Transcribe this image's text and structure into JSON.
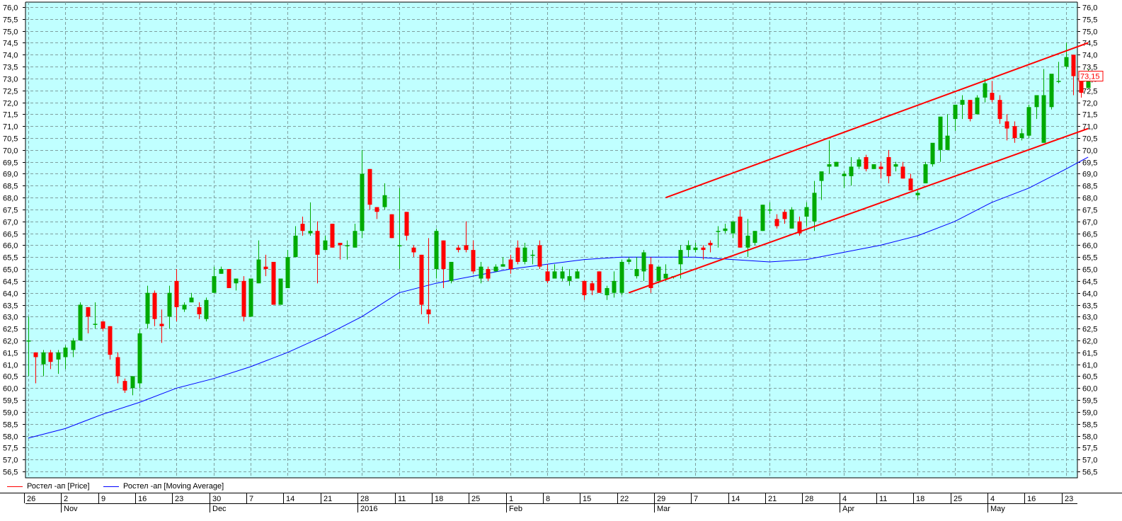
{
  "chart_data": {
    "type": "candlestick",
    "title": "",
    "y_range": [
      56.5,
      76.0
    ],
    "y_tick_step": 0.5,
    "last_price_label": "73,15",
    "colors": {
      "up": "#00aa00",
      "down": "#ff0000",
      "moving_average": "#0000ff",
      "background": "#c0ffff",
      "channel": "#ff0000"
    },
    "grid": true,
    "x_ticks": [
      {
        "label": "26",
        "i": 0
      },
      {
        "label": "2",
        "i": 5
      },
      {
        "label": "9",
        "i": 10
      },
      {
        "label": "16",
        "i": 15
      },
      {
        "label": "23",
        "i": 20
      },
      {
        "label": "30",
        "i": 25
      },
      {
        "label": "7",
        "i": 30
      },
      {
        "label": "14",
        "i": 35
      },
      {
        "label": "21",
        "i": 40
      },
      {
        "label": "28",
        "i": 45
      },
      {
        "label": "11",
        "i": 50
      },
      {
        "label": "18",
        "i": 55
      },
      {
        "label": "25",
        "i": 60
      },
      {
        "label": "1",
        "i": 65
      },
      {
        "label": "8",
        "i": 70
      },
      {
        "label": "15",
        "i": 75
      },
      {
        "label": "22",
        "i": 80
      },
      {
        "label": "29",
        "i": 85
      },
      {
        "label": "7",
        "i": 90
      },
      {
        "label": "14",
        "i": 95
      },
      {
        "label": "21",
        "i": 100
      },
      {
        "label": "28",
        "i": 105
      },
      {
        "label": "4",
        "i": 110
      },
      {
        "label": "11",
        "i": 115
      },
      {
        "label": "18",
        "i": 120
      },
      {
        "label": "25",
        "i": 125
      },
      {
        "label": "4",
        "i": 130
      },
      {
        "label": "16",
        "i": 135
      },
      {
        "label": "23",
        "i": 140
      }
    ],
    "month_labels": [
      {
        "label": "Nov",
        "i": 5
      },
      {
        "label": "Dec",
        "i": 25
      },
      {
        "label": "2016",
        "i": 45
      },
      {
        "label": "Feb",
        "i": 65
      },
      {
        "label": "Mar",
        "i": 85
      },
      {
        "label": "Apr",
        "i": 110
      },
      {
        "label": "May",
        "i": 130
      }
    ],
    "series": [
      {
        "name": "Ростел -ап [Price]",
        "kind": "ohlc",
        "ohlc": [
          [
            62.0,
            63.0,
            60.5,
            62.0
          ],
          [
            61.5,
            61.5,
            60.2,
            61.3
          ],
          [
            61.0,
            61.6,
            60.5,
            61.5
          ],
          [
            61.5,
            61.6,
            60.8,
            61.1
          ],
          [
            61.2,
            61.6,
            60.6,
            61.5
          ],
          [
            61.3,
            61.8,
            60.8,
            61.7
          ],
          [
            61.6,
            62.1,
            61.3,
            62.0
          ],
          [
            62.0,
            63.6,
            62.0,
            63.5
          ],
          [
            63.4,
            63.4,
            62.3,
            63.0
          ],
          [
            62.7,
            63.6,
            62.5,
            62.7
          ],
          [
            62.8,
            62.8,
            62.4,
            62.5
          ],
          [
            62.6,
            62.6,
            61.2,
            61.4
          ],
          [
            61.3,
            61.5,
            60.2,
            60.5
          ],
          [
            60.3,
            60.4,
            59.8,
            59.9
          ],
          [
            60.0,
            60.5,
            59.7,
            60.5
          ],
          [
            60.2,
            62.5,
            60.0,
            62.3
          ],
          [
            62.7,
            64.3,
            62.5,
            64.0
          ],
          [
            64.0,
            64.1,
            62.6,
            62.9
          ],
          [
            62.7,
            63.3,
            61.9,
            62.6
          ],
          [
            63.0,
            64.3,
            62.5,
            64.0
          ],
          [
            64.5,
            65.0,
            62.8,
            63.4
          ],
          [
            63.3,
            63.6,
            63.2,
            63.5
          ],
          [
            63.6,
            64.0,
            63.6,
            63.8
          ],
          [
            63.4,
            63.6,
            62.9,
            63.1
          ],
          [
            62.9,
            63.8,
            62.8,
            63.7
          ],
          [
            64.0,
            65.1,
            64.0,
            64.7
          ],
          [
            64.8,
            65.1,
            64.8,
            65.0
          ],
          [
            65.0,
            65.0,
            64.2,
            64.2
          ],
          [
            64.4,
            64.6,
            64.1,
            64.6
          ],
          [
            64.5,
            64.7,
            62.8,
            63.0
          ],
          [
            63.0,
            64.6,
            63.0,
            64.6
          ],
          [
            64.4,
            66.2,
            64.4,
            65.4
          ],
          [
            65.1,
            65.6,
            64.7,
            65.0
          ],
          [
            65.3,
            65.3,
            63.5,
            63.5
          ],
          [
            63.5,
            64.6,
            63.5,
            64.6
          ],
          [
            64.2,
            65.8,
            64.2,
            65.5
          ],
          [
            65.5,
            66.8,
            65.5,
            66.4
          ],
          [
            66.9,
            67.2,
            66.4,
            66.6
          ],
          [
            66.5,
            67.8,
            66.4,
            66.6
          ],
          [
            66.6,
            67.0,
            64.4,
            65.6
          ],
          [
            65.8,
            66.4,
            65.8,
            66.2
          ],
          [
            66.9,
            66.9,
            65.9,
            65.9
          ],
          [
            66.1,
            66.1,
            65.4,
            66.0
          ],
          [
            66.0,
            66.2,
            65.4,
            66.0
          ],
          [
            65.9,
            66.9,
            65.9,
            66.6
          ],
          [
            66.6,
            70.0,
            66.3,
            69.0
          ],
          [
            69.2,
            69.2,
            67.5,
            67.7
          ],
          [
            67.6,
            67.6,
            67.1,
            67.4
          ],
          [
            67.6,
            68.6,
            67.5,
            68.1
          ],
          [
            67.3,
            67.3,
            66.3,
            66.3
          ],
          [
            66.0,
            68.4,
            65.0,
            66.0
          ],
          [
            67.4,
            67.4,
            66.2,
            66.4
          ],
          [
            65.9,
            66.0,
            65.5,
            65.7
          ],
          [
            65.6,
            65.6,
            63.1,
            63.5
          ],
          [
            63.3,
            66.3,
            62.7,
            63.1
          ],
          [
            65.0,
            66.7,
            64.6,
            66.6
          ],
          [
            66.2,
            66.2,
            64.2,
            65.0
          ],
          [
            64.5,
            65.3,
            64.4,
            65.3
          ],
          [
            65.9,
            66.0,
            65.7,
            65.8
          ],
          [
            66.0,
            67.0,
            65.7,
            65.8
          ],
          [
            65.8,
            66.2,
            64.8,
            64.9
          ],
          [
            64.6,
            65.3,
            64.4,
            65.1
          ],
          [
            65.0,
            65.1,
            64.5,
            64.6
          ],
          [
            64.9,
            65.2,
            64.9,
            65.1
          ],
          [
            65.1,
            65.5,
            65.1,
            65.2
          ],
          [
            65.4,
            65.6,
            64.8,
            65.0
          ],
          [
            65.9,
            66.2,
            65.2,
            65.3
          ],
          [
            65.3,
            66.1,
            65.2,
            65.9
          ],
          [
            65.6,
            65.8,
            65.2,
            65.6
          ],
          [
            66.0,
            66.2,
            65.0,
            65.1
          ],
          [
            64.9,
            65.2,
            64.4,
            64.5
          ],
          [
            64.6,
            65.2,
            64.6,
            64.9
          ],
          [
            64.6,
            65.1,
            64.5,
            64.9
          ],
          [
            64.5,
            65.0,
            64.3,
            64.7
          ],
          [
            64.6,
            65.0,
            64.6,
            64.9
          ],
          [
            64.5,
            64.5,
            63.7,
            63.9
          ],
          [
            64.4,
            64.5,
            63.9,
            64.1
          ],
          [
            64.9,
            64.9,
            64.0,
            64.0
          ],
          [
            63.9,
            64.3,
            63.7,
            64.2
          ],
          [
            64.0,
            64.9,
            63.8,
            64.5
          ],
          [
            64.0,
            65.4,
            63.9,
            65.3
          ],
          [
            65.3,
            65.5,
            65.2,
            65.4
          ],
          [
            64.7,
            65.5,
            64.6,
            65.0
          ],
          [
            64.9,
            65.8,
            64.5,
            65.7
          ],
          [
            65.2,
            65.5,
            64.0,
            64.2
          ],
          [
            64.5,
            65.0,
            64.4,
            65.1
          ],
          [
            64.6,
            65.2,
            64.5,
            64.8
          ],
          [
            64.7,
            64.7,
            64.6,
            64.7
          ],
          [
            65.2,
            66.0,
            64.6,
            65.8
          ],
          [
            65.8,
            66.2,
            65.5,
            66.0
          ],
          [
            65.8,
            66.1,
            65.7,
            65.9
          ],
          [
            65.9,
            66.0,
            65.4,
            65.8
          ],
          [
            66.1,
            66.2,
            65.7,
            66.0
          ],
          [
            66.6,
            66.8,
            65.9,
            66.6
          ],
          [
            66.6,
            66.9,
            66.5,
            66.7
          ],
          [
            66.5,
            67.0,
            66.3,
            67.0
          ],
          [
            67.2,
            67.5,
            65.9,
            65.9
          ],
          [
            65.9,
            67.1,
            65.5,
            66.4
          ],
          [
            66.1,
            66.6,
            66.0,
            66.6
          ],
          [
            66.6,
            67.7,
            66.6,
            67.7
          ],
          [
            67.5,
            67.8,
            67.3,
            67.5
          ],
          [
            67.1,
            67.3,
            66.7,
            66.8
          ],
          [
            67.4,
            67.5,
            66.9,
            67.1
          ],
          [
            66.7,
            67.6,
            66.7,
            67.5
          ],
          [
            67.0,
            67.2,
            66.4,
            66.5
          ],
          [
            67.2,
            67.8,
            66.8,
            67.6
          ],
          [
            67.0,
            68.7,
            66.6,
            68.2
          ],
          [
            68.7,
            69.0,
            67.9,
            69.1
          ],
          [
            69.3,
            70.4,
            69.0,
            69.4
          ],
          [
            69.3,
            69.5,
            69.3,
            69.5
          ],
          [
            68.9,
            69.1,
            68.4,
            69.0
          ],
          [
            68.9,
            69.7,
            68.5,
            69.3
          ],
          [
            69.3,
            69.7,
            69.2,
            69.6
          ],
          [
            69.7,
            69.8,
            69.1,
            69.2
          ],
          [
            69.2,
            69.4,
            69.2,
            69.4
          ],
          [
            69.3,
            69.5,
            68.8,
            69.2
          ],
          [
            69.7,
            70.0,
            68.6,
            68.9
          ],
          [
            69.3,
            69.5,
            69.1,
            69.4
          ],
          [
            69.3,
            69.5,
            68.8,
            68.8
          ],
          [
            68.8,
            69.0,
            68.3,
            68.3
          ],
          [
            68.1,
            68.3,
            67.9,
            68.2
          ],
          [
            68.6,
            69.5,
            68.6,
            69.4
          ],
          [
            69.4,
            70.1,
            69.3,
            70.3
          ],
          [
            70.0,
            71.3,
            69.5,
            71.4
          ],
          [
            70.0,
            71.5,
            70.3,
            70.6
          ],
          [
            71.3,
            71.7,
            70.8,
            71.9
          ],
          [
            71.9,
            72.3,
            71.3,
            72.1
          ],
          [
            72.1,
            72.1,
            71.2,
            71.3
          ],
          [
            71.5,
            72.3,
            71.5,
            72.2
          ],
          [
            72.2,
            73.0,
            72.0,
            72.8
          ],
          [
            72.4,
            72.9,
            72.0,
            72.1
          ],
          [
            72.1,
            72.3,
            71.1,
            71.3
          ],
          [
            71.2,
            71.5,
            70.4,
            70.9
          ],
          [
            71.0,
            71.2,
            70.3,
            70.5
          ],
          [
            70.5,
            70.9,
            70.4,
            70.7
          ],
          [
            70.6,
            71.9,
            70.5,
            71.8
          ],
          [
            71.8,
            72.1,
            71.3,
            72.3
          ],
          [
            70.3,
            73.4,
            70.3,
            72.3
          ],
          [
            71.8,
            73.0,
            71.7,
            73.2
          ],
          [
            72.9,
            73.7,
            72.8,
            72.9
          ],
          [
            73.5,
            74.5,
            73.4,
            73.9
          ],
          [
            74.0,
            74.0,
            72.3,
            73.1
          ],
          [
            73.1,
            73.2,
            72.2,
            72.4
          ],
          [
            72.6,
            73.4,
            72.6,
            73.1
          ]
        ]
      },
      {
        "name": "Ростел -ап [Moving Average]",
        "kind": "line",
        "keypoints": [
          [
            0,
            57.9
          ],
          [
            5,
            58.3
          ],
          [
            10,
            58.9
          ],
          [
            15,
            59.4
          ],
          [
            20,
            60.0
          ],
          [
            25,
            60.4
          ],
          [
            30,
            60.9
          ],
          [
            35,
            61.5
          ],
          [
            40,
            62.2
          ],
          [
            45,
            63.0
          ],
          [
            50,
            64.0
          ],
          [
            55,
            64.4
          ],
          [
            60,
            64.7
          ],
          [
            65,
            65.0
          ],
          [
            70,
            65.2
          ],
          [
            75,
            65.4
          ],
          [
            80,
            65.5
          ],
          [
            85,
            65.5
          ],
          [
            90,
            65.5
          ],
          [
            95,
            65.4
          ],
          [
            100,
            65.3
          ],
          [
            105,
            65.4
          ],
          [
            110,
            65.7
          ],
          [
            115,
            66.0
          ],
          [
            120,
            66.4
          ],
          [
            125,
            67.0
          ],
          [
            130,
            67.8
          ],
          [
            135,
            68.4
          ],
          [
            140,
            69.2
          ],
          [
            143,
            69.7
          ]
        ]
      }
    ],
    "channel_lines": [
      {
        "from": [
          86,
          68.0
        ],
        "to": [
          143,
          74.5
        ]
      },
      {
        "from": [
          81,
          64.0
        ],
        "to": [
          143,
          70.9
        ]
      }
    ]
  },
  "legend": [
    {
      "label": "Ростел -ап [Price]",
      "color": "#ff0000"
    },
    {
      "label": "Ростел -ап [Moving Average]",
      "color": "#0000ff"
    }
  ]
}
